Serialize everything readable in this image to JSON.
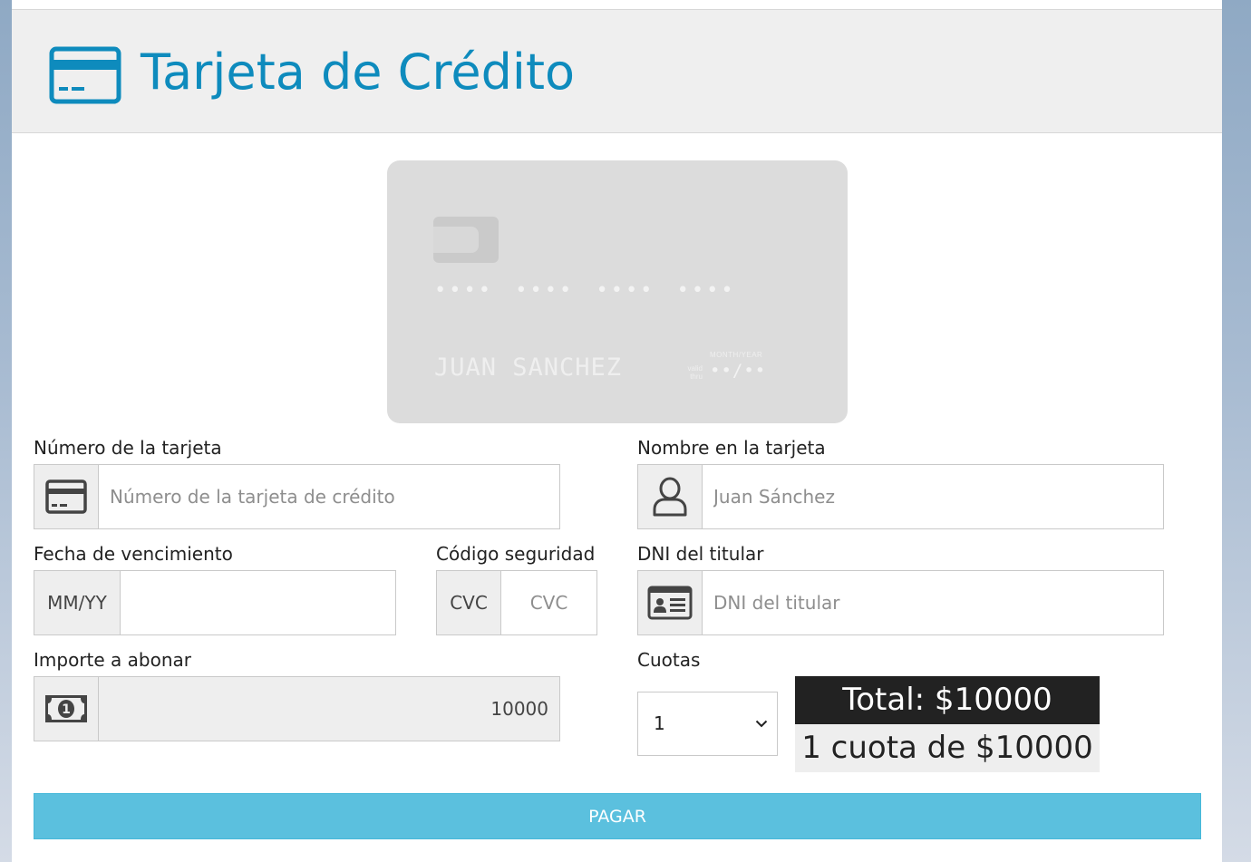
{
  "header": {
    "title": "Tarjeta de Crédito",
    "icon": "credit-card-icon",
    "accent_color": "#0e8bbd"
  },
  "card_preview": {
    "number": "•••• •••• •••• ••••",
    "holder": "JUAN SANCHEZ",
    "valid_thru": "valid thru",
    "month_year_label": "MONTH/YEAR",
    "expiry": "••/••"
  },
  "form": {
    "card_number": {
      "label": "Número de la tarjeta",
      "placeholder": "Número de la tarjeta de crédito",
      "value": "",
      "icon": "credit-card-icon"
    },
    "card_name": {
      "label": "Nombre en la tarjeta",
      "placeholder": "Juan Sánchez",
      "value": "",
      "icon": "user-icon"
    },
    "expiry": {
      "label": "Fecha de vencimiento",
      "addon": "MM/YY",
      "value": ""
    },
    "cvc": {
      "label": "Código seguridad",
      "addon": "CVC",
      "placeholder": "CVC",
      "value": ""
    },
    "dni": {
      "label": "DNI del titular",
      "placeholder": "DNI del titular",
      "value": "",
      "icon": "id-card-icon"
    },
    "amount": {
      "label": "Importe a abonar",
      "value": "10000",
      "icon": "money-bill-icon"
    },
    "quotas": {
      "label": "Cuotas",
      "selected": "1",
      "total_text": "Total: $10000",
      "quota_text": "1 cuota de $10000"
    },
    "pay_button": {
      "label": "PAGAR",
      "color": "#5bc0de"
    }
  }
}
